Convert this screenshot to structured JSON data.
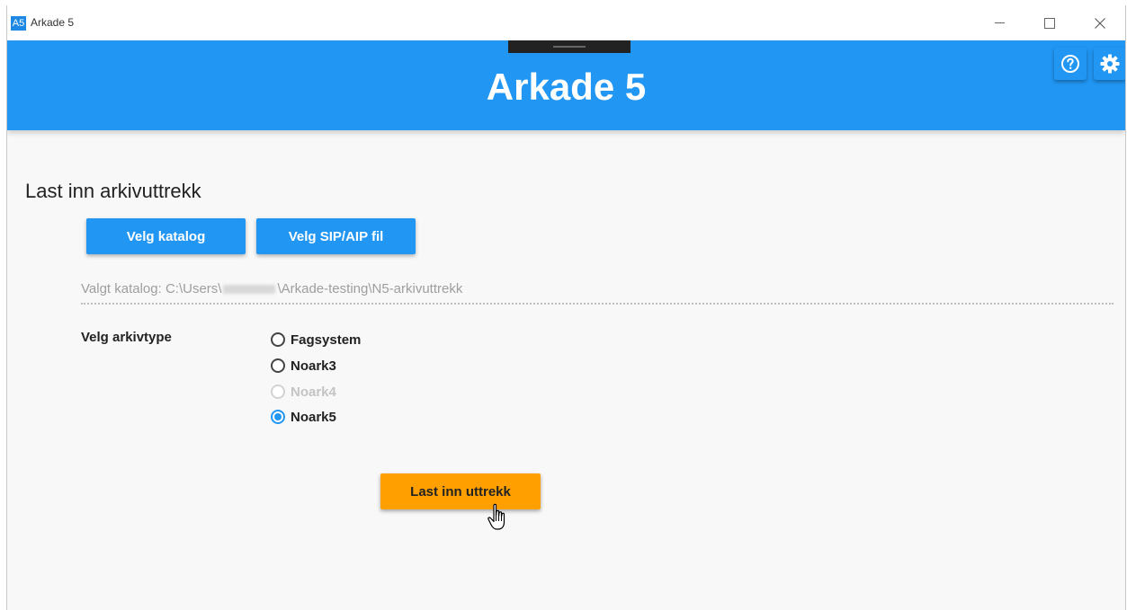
{
  "window": {
    "app_icon_text": "A5",
    "title": "Arkade 5"
  },
  "header": {
    "title": "Arkade 5",
    "color": "#2196f3",
    "help_icon": "help-circle-icon",
    "settings_icon": "gear-icon"
  },
  "load_section": {
    "title": "Last inn arkivuttrekk",
    "choose_directory_label": "Velg katalog",
    "choose_sip_label": "Velg SIP/AIP fil",
    "selected_path_prefix": "Valgt katalog: C:\\Users\\",
    "selected_path_suffix": "\\Arkade-testing\\N5-arkivuttrekk"
  },
  "archive_type": {
    "label": "Velg arkivtype",
    "options": [
      {
        "label": "Fagsystem",
        "checked": false,
        "disabled": false
      },
      {
        "label": "Noark3",
        "checked": false,
        "disabled": false
      },
      {
        "label": "Noark4",
        "checked": false,
        "disabled": true
      },
      {
        "label": "Noark5",
        "checked": true,
        "disabled": false
      }
    ]
  },
  "actions": {
    "load_label": "Last inn uttrekk",
    "load_color": "#ffa000"
  }
}
